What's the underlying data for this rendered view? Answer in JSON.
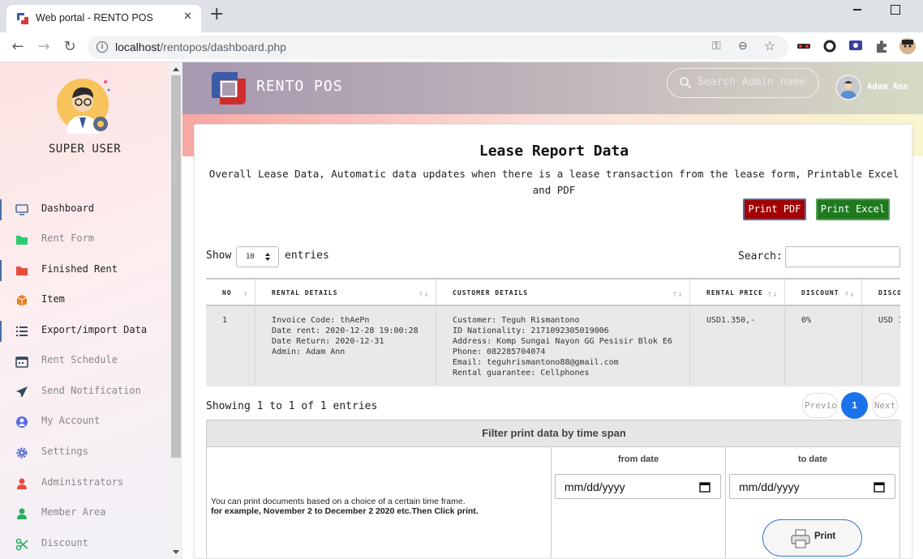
{
  "browser": {
    "tab_title": "Web portal - RENTO POS",
    "tab_close": "✕",
    "new_tab": "+",
    "url_host": "localhost",
    "url_path": "/rentopos/dashboard.php",
    "favicon": "rento-logo-icon",
    "nav": {
      "back": "←",
      "forward": "→",
      "reload": "↻"
    },
    "omni_icons": {
      "key": "⚿",
      "zoom": "⊖",
      "star": "☆"
    }
  },
  "sidebar": {
    "role": "SUPER USER",
    "items": [
      {
        "label": "Dashboard",
        "icon": "monitor-icon",
        "color": "#4a6fa5",
        "active": true,
        "dark": true
      },
      {
        "label": "Rent Form",
        "icon": "folder-icon",
        "color": "#2ecc71",
        "active": false,
        "dark": false
      },
      {
        "label": "Finished Rent",
        "icon": "folder-icon",
        "color": "#e74c3c",
        "active": true,
        "dark": true
      },
      {
        "label": "Item",
        "icon": "cube-icon",
        "color": "#e67e22",
        "active": false,
        "dark": true
      },
      {
        "label": "Export/import Data",
        "icon": "list-icon",
        "color": "#34495e",
        "active": true,
        "dark": true
      },
      {
        "label": "Rent Schedule",
        "icon": "calendar-icon",
        "color": "#34495e",
        "active": false,
        "dark": false
      },
      {
        "label": "Send Notification",
        "icon": "send-icon",
        "color": "#34495e",
        "active": false,
        "dark": false
      },
      {
        "label": "My Account",
        "icon": "user-circle-icon",
        "color": "#5b6bdc",
        "active": false,
        "dark": false
      },
      {
        "label": "Settings",
        "icon": "gear-icon",
        "color": "#5b6bdc",
        "active": false,
        "dark": false
      },
      {
        "label": "Administrators",
        "icon": "user-icon",
        "color": "#e74c3c",
        "active": false,
        "dark": false
      },
      {
        "label": "Member Area",
        "icon": "user-icon",
        "color": "#27ae60",
        "active": false,
        "dark": false
      },
      {
        "label": "Discount",
        "icon": "scissors-icon",
        "color": "#27ae60",
        "active": false,
        "dark": false
      }
    ]
  },
  "header": {
    "brand": "RENTO POS",
    "search_placeholder": "Search Admin name",
    "user_name": "Adam Ann"
  },
  "card": {
    "title": "Lease Report Data",
    "description": "Overall Lease Data, Automatic data updates when there is a lease transaction from the lease form, Printable Excel and PDF",
    "print_pdf": "Print PDF",
    "print_excel": "Print Excel",
    "show_label": "Show",
    "entries_value": "10",
    "entries_label": "entries",
    "search_label": "Search:"
  },
  "table": {
    "columns": [
      "NO",
      "RENTAL DETAILS",
      "CUSTOMER DETAILS",
      "RENTAL PRICE",
      "DISCOUNT",
      "DISCO"
    ],
    "rows": [
      {
        "no": "1",
        "rental_details": [
          "Invoice Code: thAePn",
          "Date rent: 2020-12-28 19:00:28",
          "Date Return: 2020-12-31",
          "Admin: Adam Ann"
        ],
        "customer_details": [
          "Customer: Teguh Rismantono",
          "ID Nationality: 2171092305019006",
          "Address: Komp Sungai Nayon GG Pesisir Blok E6",
          "Phone: 082285704074",
          "Email: teguhrismantono88@gmail.com",
          "Rental guarantee: Cellphones"
        ],
        "rental_price": "USD1.350,-",
        "discount": "0%",
        "disco": "USD 1"
      }
    ]
  },
  "pagination": {
    "showing": "Showing 1 to 1 of 1 entries",
    "previous": "Previous",
    "current": "1",
    "next": "Next"
  },
  "filter": {
    "title": "Filter print data by time span",
    "desc_line1": "You can print documents based on a choice of a certain time frame.",
    "desc_line2": "for example, November 2 to December 2 2020 etc.Then Click print.",
    "from_label": "from date",
    "to_label": "to date",
    "from_value": "mm/dd/yyyy",
    "to_value": "mm/dd/yyyy",
    "print_label": "Print"
  }
}
